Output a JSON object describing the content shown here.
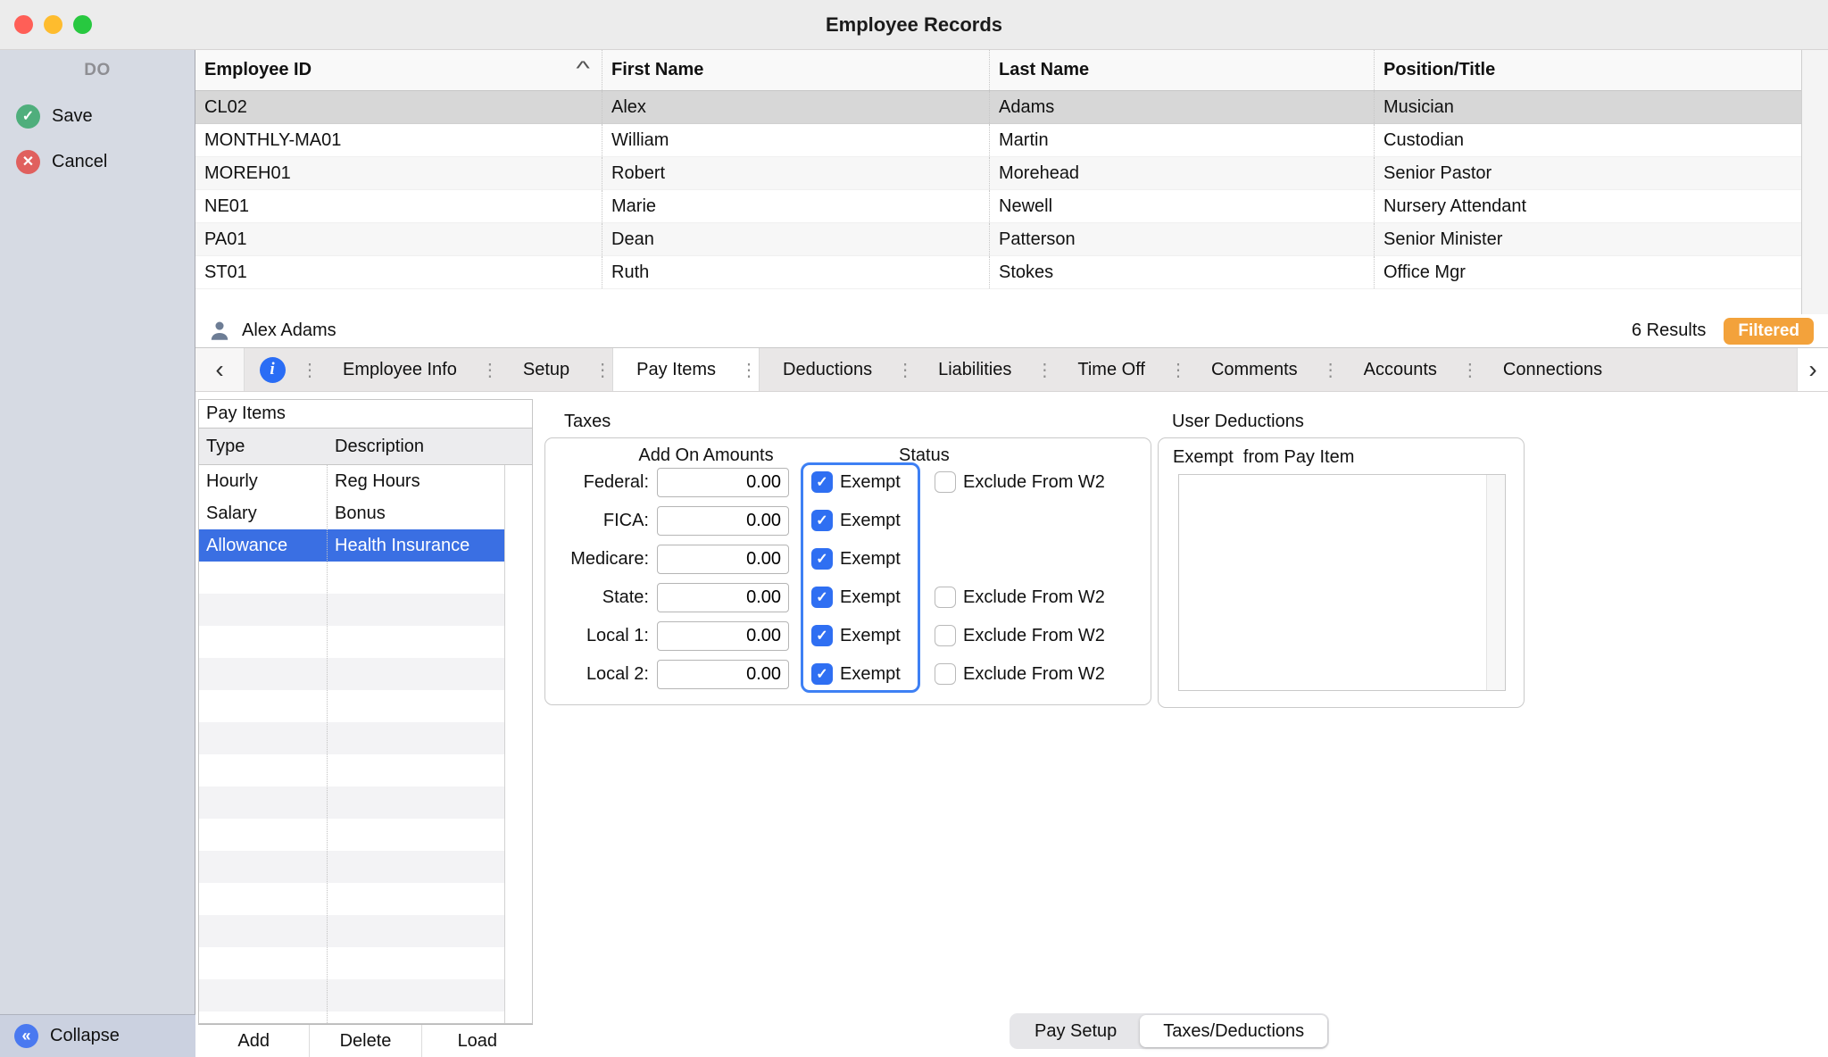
{
  "window": {
    "title": "Employee Records"
  },
  "icons": {
    "check": "✓",
    "cross": "✕",
    "collapse": "«",
    "chev_left": "‹",
    "chev_right": "›",
    "handle": "⋮",
    "info": "i",
    "sort": "^"
  },
  "colors": {
    "accent_blue": "#2f6ff2",
    "selection_blue": "#3a6fe3",
    "filtered_orange": "#f3a23b",
    "selected_row_gray": "#d7d7d7",
    "save_green": "#4fae7c",
    "cancel_red": "#e0605e"
  },
  "sidebar": {
    "header": "DO",
    "save": "Save",
    "cancel": "Cancel",
    "collapse": "Collapse"
  },
  "employee_table": {
    "columns": [
      "Employee ID",
      "First Name",
      "Last Name",
      "Position/Title"
    ],
    "sorted_by": "Employee ID",
    "rows": [
      {
        "id": "CL02",
        "first": "Alex",
        "last": "Adams",
        "position": "Musician"
      },
      {
        "id": "MONTHLY-MA01",
        "first": "William",
        "last": "Martin",
        "position": "Custodian"
      },
      {
        "id": "MOREH01",
        "first": "Robert",
        "last": "Morehead",
        "position": "Senior Pastor"
      },
      {
        "id": "NE01",
        "first": "Marie",
        "last": "Newell",
        "position": "Nursery Attendant"
      },
      {
        "id": "PA01",
        "first": "Dean",
        "last": "Patterson",
        "position": "Senior Minister"
      },
      {
        "id": "ST01",
        "first": "Ruth",
        "last": "Stokes",
        "position": "Office Mgr"
      }
    ],
    "selected_id": "CL02"
  },
  "summary": {
    "name": "Alex Adams",
    "results": "6 Results",
    "filtered": "Filtered"
  },
  "tabs": {
    "labels": [
      "Employee Info",
      "Setup",
      "Pay Items",
      "Deductions",
      "Liabilities",
      "Time Off",
      "Comments",
      "Accounts",
      "Connections"
    ],
    "active": "Pay Items"
  },
  "pay_items": {
    "title": "Pay Items",
    "columns": [
      "Type",
      "Description"
    ],
    "rows": [
      [
        "Hourly",
        "Reg Hours"
      ],
      [
        "Salary",
        "Bonus"
      ],
      [
        "Allowance",
        "Health Insurance"
      ]
    ],
    "selected_index": 2,
    "buttons": [
      "Add",
      "Delete",
      "Load"
    ]
  },
  "taxes": {
    "title": "Taxes",
    "amounts_header": "Add On Amounts",
    "status_header": "Status",
    "exempt_label": "Exempt",
    "exclude_label": "Exclude From W2",
    "rows": [
      {
        "label": "Federal:",
        "amount": "0.00",
        "exempt": true,
        "has_exclude": true,
        "exclude": false
      },
      {
        "label": "FICA:",
        "amount": "0.00",
        "exempt": true,
        "has_exclude": false
      },
      {
        "label": "Medicare:",
        "amount": "0.00",
        "exempt": true,
        "has_exclude": false
      },
      {
        "label": "State:",
        "amount": "0.00",
        "exempt": true,
        "has_exclude": true,
        "exclude": false
      },
      {
        "label": "Local 1:",
        "amount": "0.00",
        "exempt": true,
        "has_exclude": true,
        "exclude": false
      },
      {
        "label": "Local 2:",
        "amount": "0.00",
        "exempt": true,
        "has_exclude": true,
        "exclude": false
      }
    ]
  },
  "user_deductions": {
    "title": "User Deductions",
    "subtitle": "Exempt  from Pay Item"
  },
  "footer_tabs": {
    "items": [
      "Pay Setup",
      "Taxes/Deductions"
    ],
    "active": "Taxes/Deductions"
  }
}
